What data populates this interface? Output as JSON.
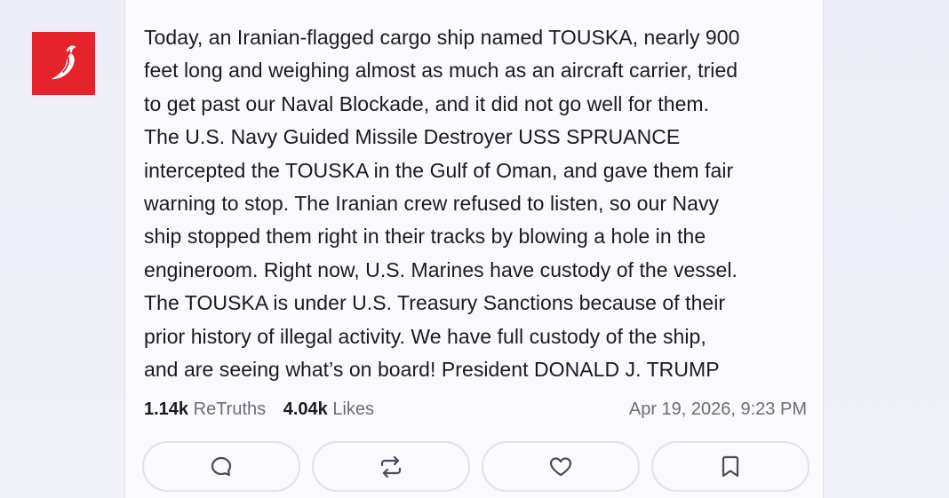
{
  "post": {
    "lines": [
      "Today, an Iranian-flagged cargo ship named TOUSKA, nearly 900",
      "feet long and weighing almost as much as an aircraft carrier, tried",
      "to get past our Naval Blockade, and it did not go well for them.",
      "The U.S. Navy Guided Missile Destroyer USS SPRUANCE",
      "intercepted the TOUSKA in the Gulf of Oman, and gave them fair",
      "warning to stop. The Iranian crew refused to listen, so our Navy",
      "ship stopped them right in their tracks by blowing a hole in the",
      "engineroom. Right now, U.S. Marines have custody of the vessel.",
      "The TOUSKA is under U.S. Treasury Sanctions because of their",
      "prior history of illegal activity. We have full custody of the ship,",
      "and are seeing what’s on board! President DONALD J. TRUMP"
    ]
  },
  "stats": {
    "retruths_count": "1.14k",
    "retruths_label": "ReTruths",
    "likes_count": "4.04k",
    "likes_label": "Likes",
    "timestamp": "Apr 19, 2026, 9:23 PM"
  },
  "actions": {
    "reply_icon": "comment-icon",
    "retruth_icon": "repost-icon",
    "like_icon": "heart-icon",
    "bookmark_icon": "bookmark-icon"
  },
  "avatar": {
    "icon": "chili-pepper-icon",
    "color": "#e5232b"
  }
}
